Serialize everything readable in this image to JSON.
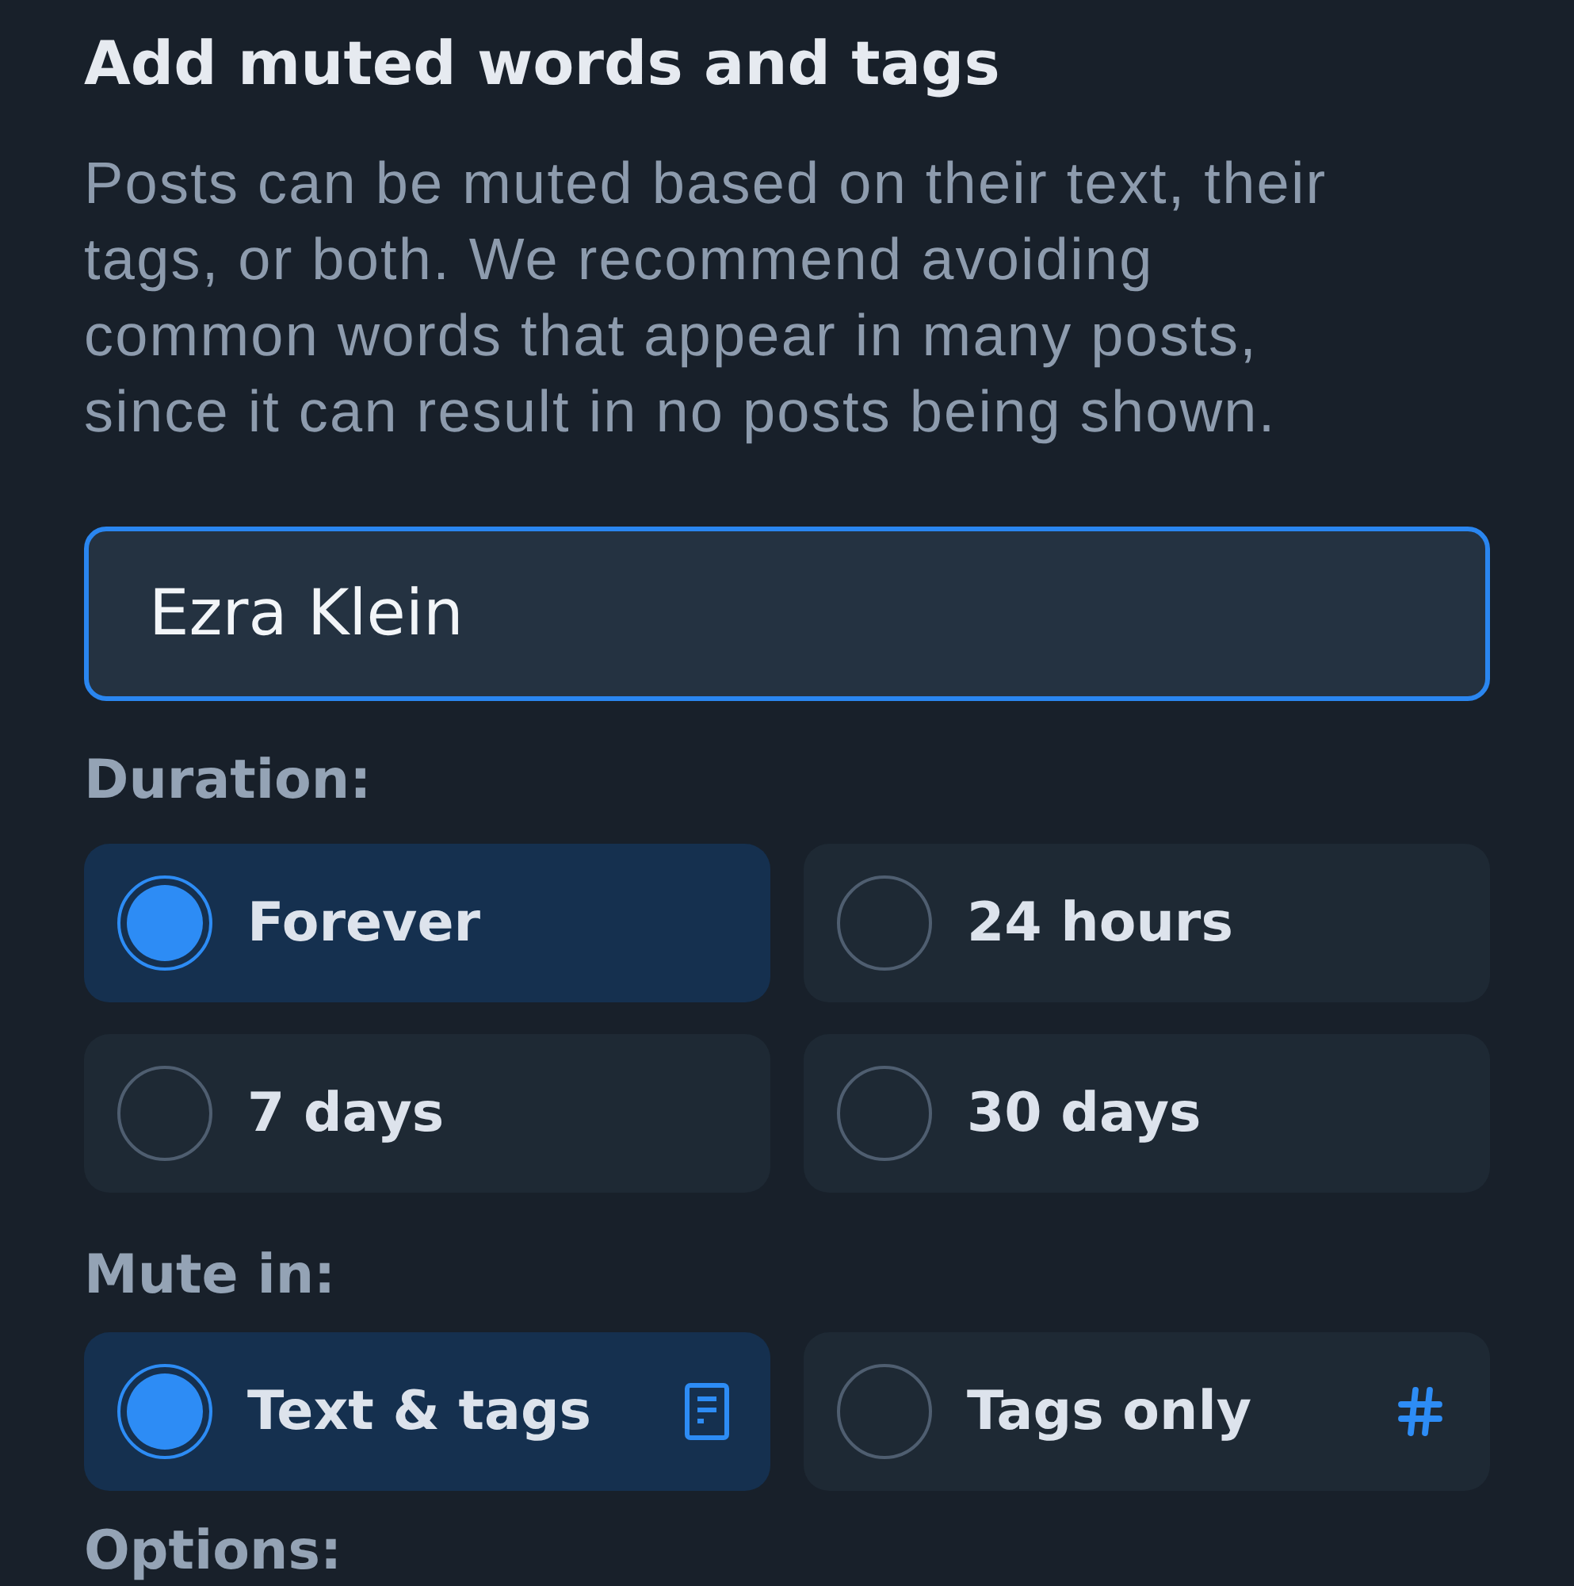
{
  "header": {
    "title": "Add muted words and tags"
  },
  "description": "Posts can be muted based on their text, their tags, or both. We recommend avoiding common words that appear in many posts, since it can result in no posts being shown.",
  "word_field": {
    "value": "Ezra Klein",
    "focused": true
  },
  "duration": {
    "label": "Duration:",
    "options": [
      {
        "label": "Forever",
        "selected": true
      },
      {
        "label": "24 hours",
        "selected": false
      },
      {
        "label": "7 days",
        "selected": false
      },
      {
        "label": "30 days",
        "selected": false
      }
    ]
  },
  "mute_in": {
    "label": "Mute in:",
    "options": [
      {
        "label": "Text & tags",
        "selected": true,
        "kind": "text"
      },
      {
        "label": "Tags only",
        "selected": false,
        "kind": "tags"
      }
    ]
  },
  "options_section": {
    "label": "Options:"
  }
}
